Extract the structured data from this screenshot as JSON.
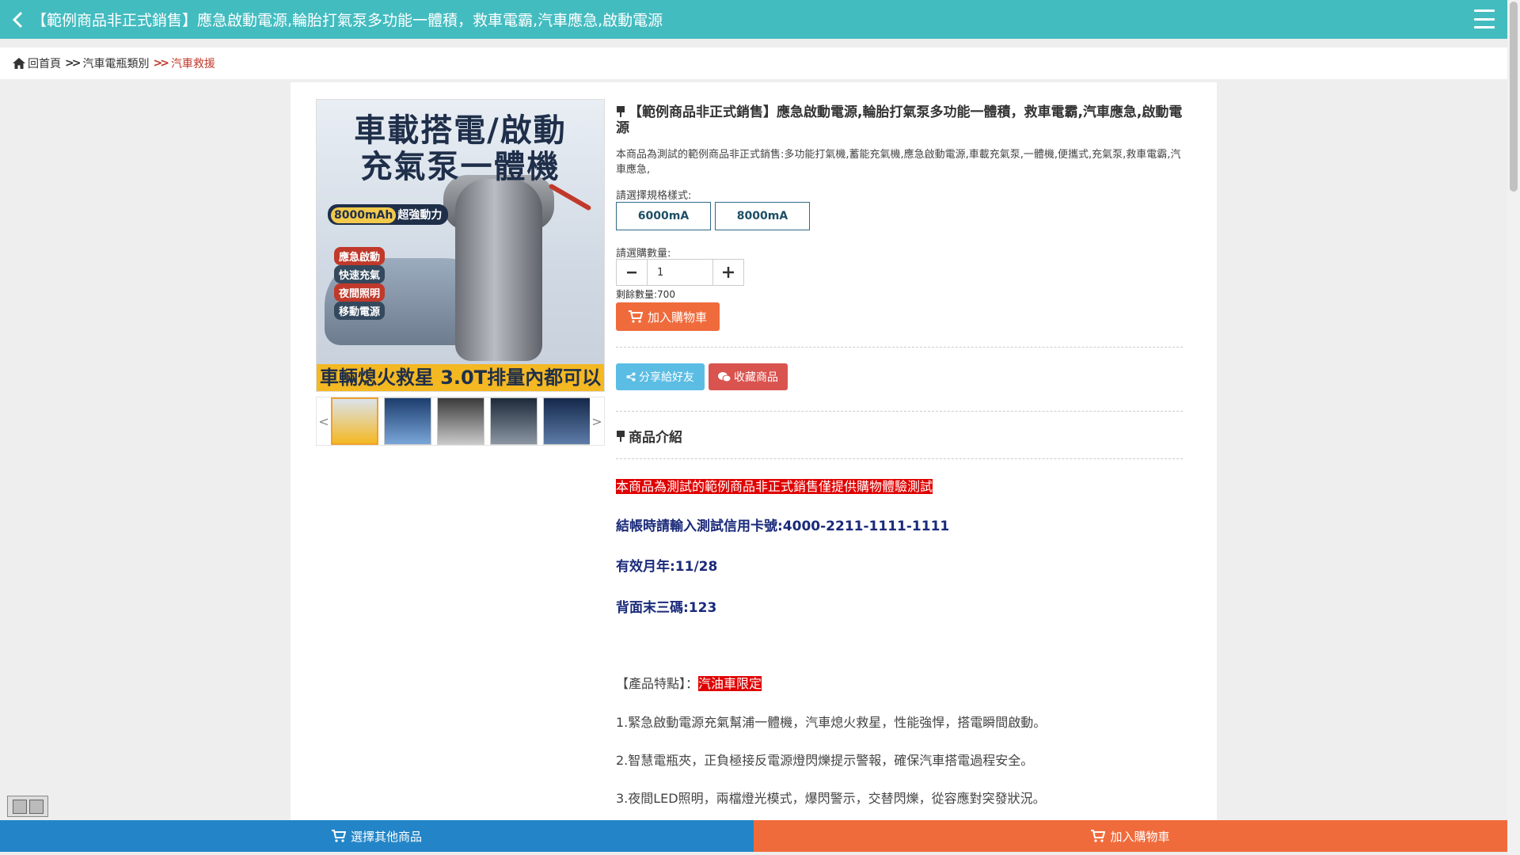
{
  "header": {
    "title": "【範例商品非正式銷售】應急啟動電源,輪胎打氣泵多功能一體積，救車電霸,汽車應急,啟動電源"
  },
  "breadcrumb": {
    "home": "回首頁",
    "category": "汽車電瓶類別",
    "current": "汽車救援"
  },
  "product_image": {
    "headline_1": "車載搭電/啟動",
    "headline_2": "充氣泵一體機",
    "badge_mah": "8000mAh",
    "badge_text": "超強動力",
    "features": [
      "應急啟動",
      "快速充氣",
      "夜間照明",
      "移動電源"
    ],
    "footer": "車輛熄火救星 3.0T排量內都可以"
  },
  "product": {
    "title": "【範例商品非正式銷售】應急啟動電源,輪胎打氣泵多功能一體積，救車電霸,汽車應急,啟動電源",
    "description": "本商品為測試的範例商品非正式銷售:多功能打氣機,蓄能充氣機,應急啟動電源,車載充氣泵,一體機,便攜式,充氣泵,救車電霸,汽車應急,",
    "spec_label": "請選擇規格樣式:",
    "specs": [
      "6000mA",
      "8000mA"
    ],
    "qty_label": "請選購數量:",
    "qty_value": "1",
    "stock": "剩餘數量:700",
    "add_to_cart": "加入購物車",
    "share": "分享給好友",
    "favorite": "收藏商品",
    "intro_heading": "商品介紹"
  },
  "intro": {
    "notice": "本商品為測試的範例商品非正式銷售僅提供購物體驗測試",
    "card_line": "結帳時請輸入測試信用卡號:4000-2211-1111-1111",
    "expiry_line": "有效月年:11/28",
    "cvv_line": "背面末三碼:123",
    "features_label": "【產品特點】：",
    "features_tag": "汽油車限定",
    "point_1": "1.緊急啟動電源充氣幫浦一體機，汽車熄火救星，性能強悍，搭電瞬間啟動。",
    "point_2": "2.智慧電瓶夾，正負極接反電源燈閃爍提示警報，確保汽車搭電過程安全。",
    "point_3": "3.夜間LED照明，兩檔燈光模式，爆閃警示，交替閃爍，從容應對突發狀況。"
  },
  "bottom_bar": {
    "choose_other": "選擇其他商品",
    "add_to_cart": "加入購物車"
  },
  "colors": {
    "header": "#43bcc0",
    "accent_orange": "#f06b3c",
    "bottom_blue": "#2385c7",
    "highlight_red": "#e00000",
    "navy_text": "#1a2a7a"
  }
}
